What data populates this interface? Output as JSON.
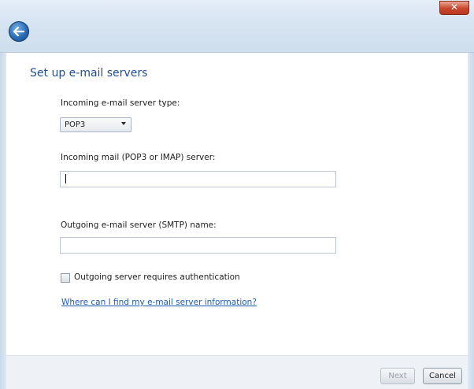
{
  "window": {
    "close_glyph": "✕"
  },
  "nav": {
    "back_glyph": "←"
  },
  "page": {
    "title": "Set up e-mail servers"
  },
  "form": {
    "incoming_type_label": "Incoming e-mail server type:",
    "incoming_type_value": "POP3",
    "incoming_server_label": "Incoming mail (POP3 or IMAP) server:",
    "incoming_server_value": "",
    "outgoing_server_label": "Outgoing e-mail server (SMTP) name:",
    "outgoing_server_value": "",
    "auth_checkbox_label": "Outgoing server requires authentication",
    "auth_checked": false,
    "help_link": "Where can I find my e-mail server information?"
  },
  "footer": {
    "next_label": "Next",
    "cancel_label": "Cancel"
  },
  "colors": {
    "title": "#1f4e96",
    "link": "#1c5cb4",
    "close": "#c9442a"
  }
}
